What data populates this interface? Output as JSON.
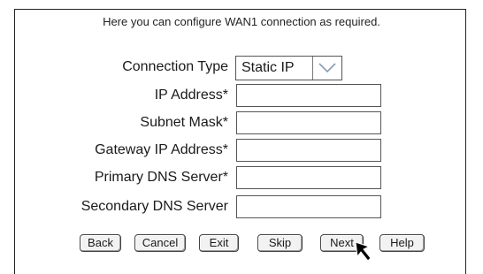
{
  "intro_text": "Here you can configure WAN1 connection as required.",
  "connection_type": {
    "label": "Connection Type",
    "selected": "Static IP"
  },
  "fields": [
    {
      "label": "IP Address*",
      "value": ""
    },
    {
      "label": "Subnet Mask*",
      "value": ""
    },
    {
      "label": "Gateway IP Address*",
      "value": ""
    },
    {
      "label": "Primary DNS Server*",
      "value": ""
    },
    {
      "label": "Secondary DNS Server",
      "value": ""
    }
  ],
  "buttons": {
    "back": "Back",
    "cancel": "Cancel",
    "exit": "Exit",
    "skip": "Skip",
    "next": "Next",
    "help": "Help"
  },
  "icons": {
    "dropdown": "chevron-down-icon",
    "cursor": "mouse-pointer-icon"
  }
}
